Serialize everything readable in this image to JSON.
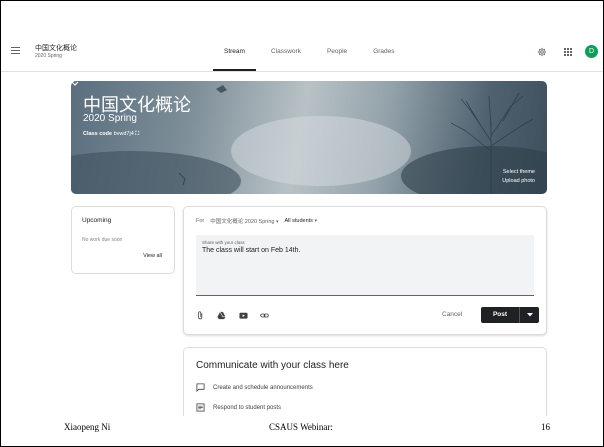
{
  "header": {
    "class_name": "中国文化概论",
    "class_term": "2020 Spring",
    "tabs": [
      {
        "label": "Stream"
      },
      {
        "label": "Classwork"
      },
      {
        "label": "People"
      },
      {
        "label": "Grades"
      }
    ],
    "avatar_letter": "D",
    "active_tab": "Stream"
  },
  "banner": {
    "title": "中国文化概论",
    "subtitle": "2020 Spring",
    "class_code_label": "Class code",
    "class_code": "bvwd7j4",
    "select_theme": "Select theme",
    "upload_photo": "Upload photo"
  },
  "upcoming": {
    "title": "Upcoming",
    "empty_text": "No work due soon",
    "view_all": "View all"
  },
  "composer": {
    "for_label": "For",
    "class_select": "中国文化概论 2020 Spring",
    "audience_select": "All students",
    "field_label": "Share with your class",
    "field_value": "The class will start on Feb 14th.",
    "cancel": "Cancel",
    "post": "Post"
  },
  "communicate": {
    "title": "Communicate with your class here",
    "items": [
      {
        "label": "Create and schedule announcements"
      },
      {
        "label": "Respond to student posts"
      }
    ]
  },
  "footer": {
    "author": "Xiaopeng Ni",
    "event": "CSAUS Webinar:",
    "page": "16"
  },
  "colors": {
    "avatar": "#0f9d58",
    "post_button": "#202124"
  }
}
